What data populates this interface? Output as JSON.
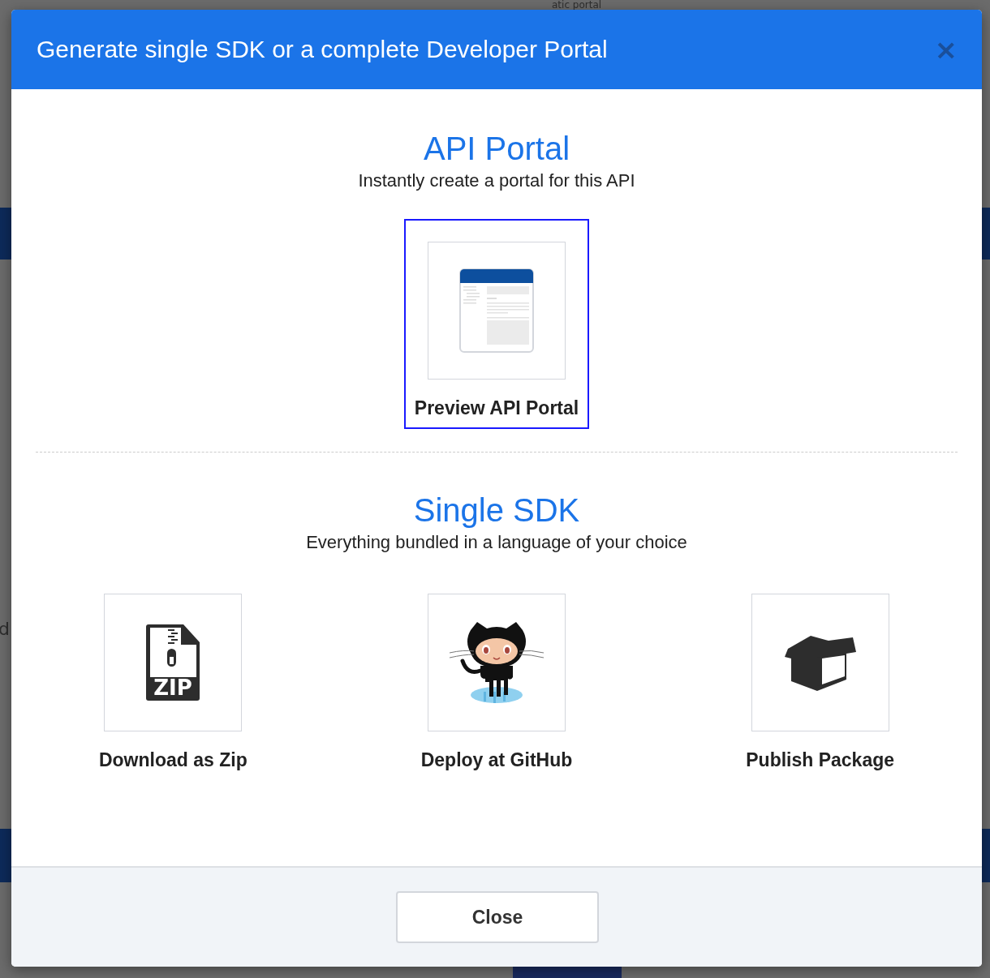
{
  "backdrop": {
    "texts": [
      {
        "kind": "top",
        "text": "atic portal"
      },
      {
        "kind": "left-2",
        "text": "d"
      }
    ]
  },
  "dialog": {
    "title": "Generate single SDK or a complete Developer Portal",
    "close_icon": "×",
    "sections": [
      {
        "title": "API Portal",
        "subtitle": "Instantly create a portal for this API",
        "options": [
          {
            "kind": "portal",
            "label": "Preview API Portal",
            "selected": true
          }
        ]
      },
      {
        "title": "Single SDK",
        "subtitle": "Everything bundled in a language of your choice",
        "options": [
          {
            "kind": "zip",
            "label": "Download as Zip",
            "icon_text": "ZIP",
            "selected": false
          },
          {
            "kind": "github",
            "label": "Deploy at GitHub",
            "selected": false
          },
          {
            "kind": "package",
            "label": "Publish Package",
            "selected": false
          }
        ]
      }
    ],
    "footer": {
      "button": "Close"
    }
  }
}
